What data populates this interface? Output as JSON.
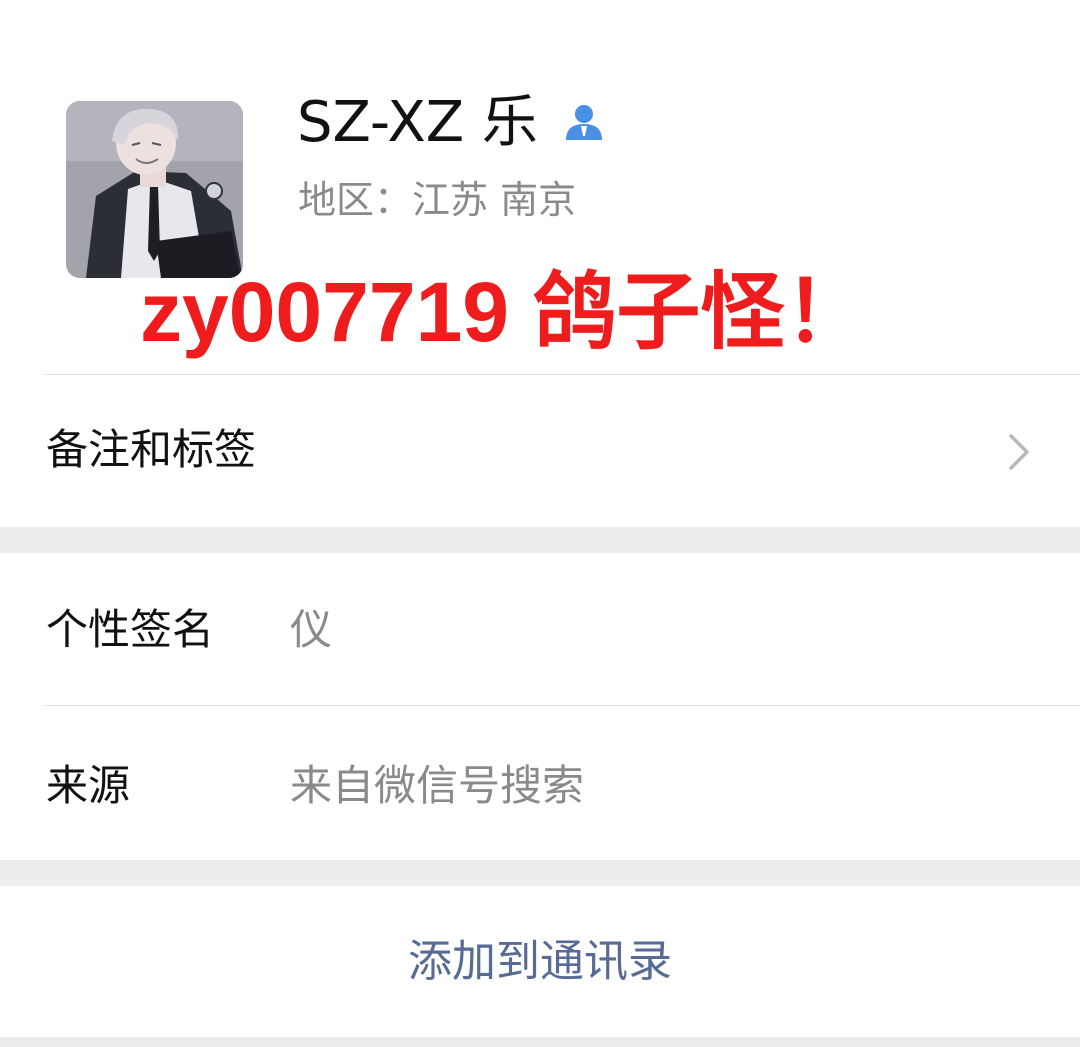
{
  "profile": {
    "nickname": "SZ-XZ 乐",
    "region_label": "地区：",
    "region_value": "江苏 南京",
    "contact_icon": "person-icon",
    "overlay_text": "zy007719 鸽子怪！",
    "overlay_color": "#ee1c1c"
  },
  "remark_row": {
    "label": "备注和标签",
    "icon": "chevron-right-icon"
  },
  "signature_row": {
    "label": "个性签名",
    "value": "仪"
  },
  "source_row": {
    "label": "来源",
    "value": "来自微信号搜索"
  },
  "actions": {
    "add_to_contacts": "添加到通讯录",
    "link_color": "#576b95"
  }
}
